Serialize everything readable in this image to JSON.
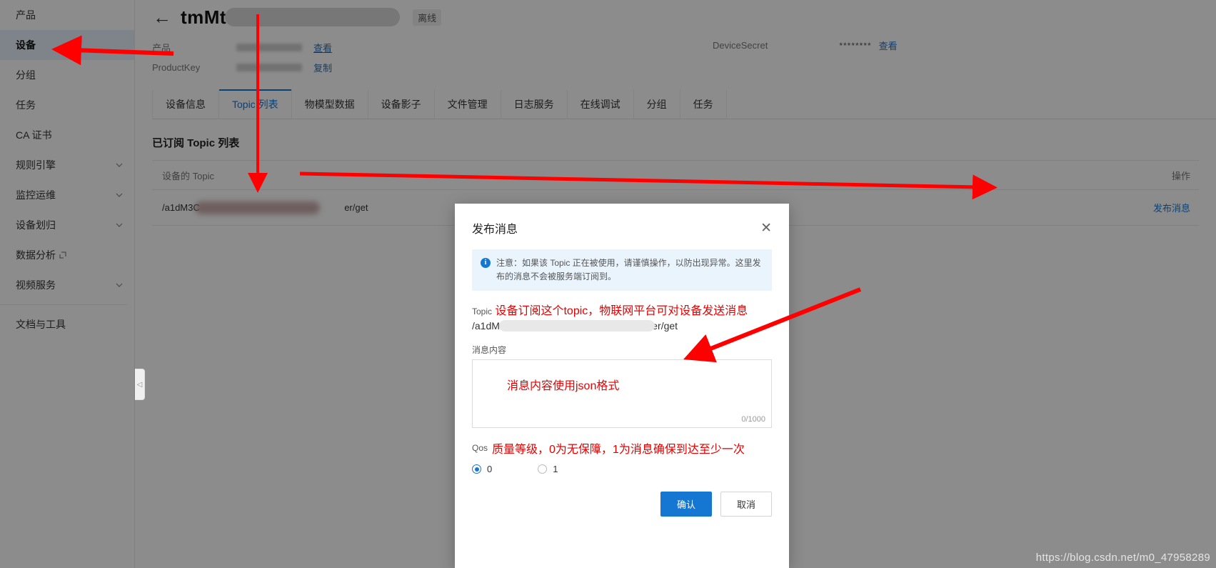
{
  "sidebar": {
    "items": [
      {
        "label": "产品",
        "active": false,
        "expandable": false,
        "external": false
      },
      {
        "label": "设备",
        "active": true,
        "expandable": false,
        "external": false
      },
      {
        "label": "分组",
        "active": false,
        "expandable": false,
        "external": false
      },
      {
        "label": "任务",
        "active": false,
        "expandable": false,
        "external": false
      },
      {
        "label": "CA 证书",
        "active": false,
        "expandable": false,
        "external": false
      },
      {
        "label": "规则引擎",
        "active": false,
        "expandable": true,
        "external": false
      },
      {
        "label": "监控运维",
        "active": false,
        "expandable": true,
        "external": false
      },
      {
        "label": "设备划归",
        "active": false,
        "expandable": true,
        "external": false
      },
      {
        "label": "数据分析",
        "active": false,
        "expandable": false,
        "external": true
      },
      {
        "label": "视频服务",
        "active": false,
        "expandable": true,
        "external": false
      }
    ],
    "footer_item": {
      "label": "文档与工具"
    },
    "collapse_icon": "chevron-left-icon"
  },
  "header": {
    "back_icon": "back-arrow-icon",
    "device_title": "tmMt",
    "status_badge": "离线",
    "meta": [
      {
        "label": "产品",
        "action": "查看"
      },
      {
        "label": "ProductKey",
        "action": "复制"
      }
    ],
    "device_secret": {
      "label": "DeviceSecret",
      "masked": "********",
      "action": "查看"
    }
  },
  "tabs": [
    {
      "label": "设备信息",
      "active": false
    },
    {
      "label": "Topic 列表",
      "active": true
    },
    {
      "label": "物模型数据",
      "active": false
    },
    {
      "label": "设备影子",
      "active": false
    },
    {
      "label": "文件管理",
      "active": false
    },
    {
      "label": "日志服务",
      "active": false
    },
    {
      "label": "在线调试",
      "active": false
    },
    {
      "label": "分组",
      "active": false
    },
    {
      "label": "任务",
      "active": false
    }
  ],
  "content": {
    "section_title": "已订阅 Topic 列表",
    "table": {
      "columns": [
        "设备的 Topic",
        "操作"
      ],
      "rows": [
        {
          "topic_prefix": "/a1dM3C",
          "topic_suffix": "er/get",
          "action": "发布消息"
        }
      ]
    }
  },
  "modal": {
    "title": "发布消息",
    "close_icon": "close-icon",
    "alert_icon": "info-icon",
    "alert_text": "注意：如果该 Topic 正在被使用，请谨慎操作，以防出现异常。这里发布的消息不会被服务端订阅到。",
    "topic_label": "Topic",
    "topic_annotation": "设备订阅这个topic，物联网平台可对设备发送消息",
    "topic_value_prefix": "/a1dM",
    "topic_value_suffix": "/user/get",
    "message_label": "消息内容",
    "message_annotation": "消息内容使用json格式",
    "message_value": "",
    "message_counter": "0/1000",
    "qos_label": "Qos",
    "qos_annotation": "质量等级，0为无保障，1为消息确保到达至少一次",
    "qos_options": [
      {
        "label": "0",
        "selected": true
      },
      {
        "label": "1",
        "selected": false
      }
    ],
    "confirm_label": "确认",
    "cancel_label": "取消"
  },
  "watermark": {
    "text": "https://blog.csdn.net/m0_47958289"
  },
  "colors": {
    "accent": "#1677d2",
    "annotation_red": "#e60000",
    "alert_bg": "#eaf4fd",
    "sidebar_active": "#e6f0fb"
  }
}
